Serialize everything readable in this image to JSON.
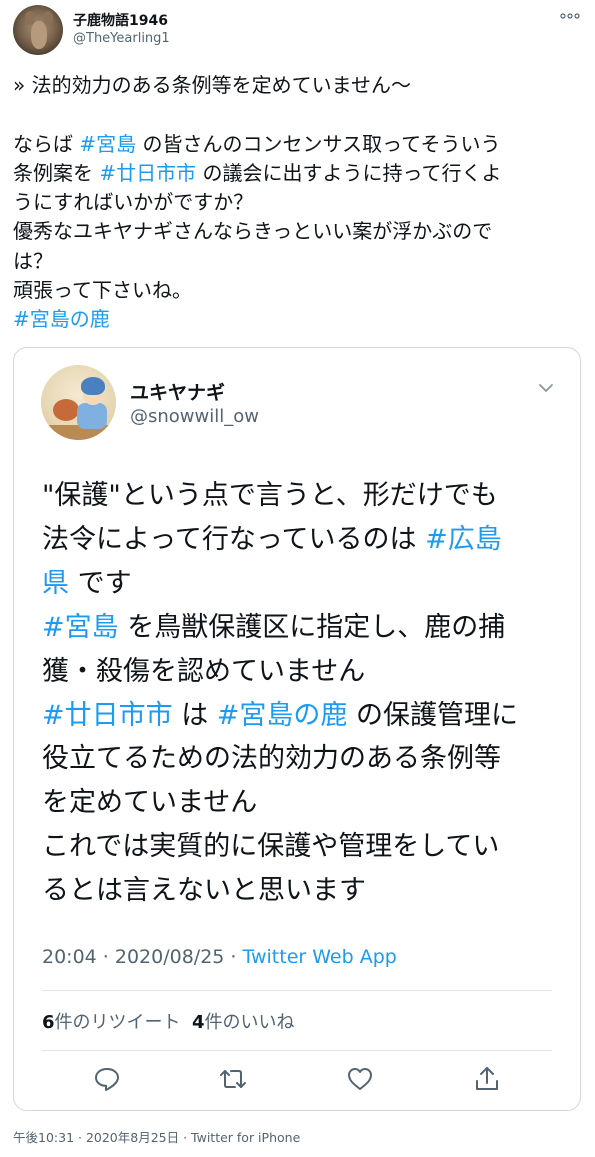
{
  "author": {
    "name": "子鹿物語1946",
    "handle": "@TheYearling1"
  },
  "more_menu": "◦◦◦",
  "tweet": {
    "lines": [
      "» 法的効力のある条例等を定めていません〜",
      "",
      "ならば ",
      "#宮島",
      " の皆さんのコンセンサス取ってそういう",
      "条例案を ",
      "#廿日市市",
      " の議会に出すように持って行くよ",
      "うにすればいかがですか？",
      "優秀なユキヤナギさんならきっといい案が浮かぶので",
      "は？",
      "頑張って下さいね。",
      "#宮島の鹿"
    ]
  },
  "quoted": {
    "name": "ユキヤナギ",
    "handle": "@snowwill_ow",
    "text": {
      "p1": "\"保護\"という点で言うと、形だけでも",
      "p2a": "法令によって行なっているのは ",
      "tag_hiroshima_a": "#広島",
      "tag_hiroshima_b": "県",
      "p2b": " です",
      "tag_miyajima": "#宮島",
      "p3a": " を鳥獣保護区に指定し、鹿の捕",
      "p3b": "獲・殺傷を認めていません",
      "tag_hatsukaichi": "#廿日市市",
      "p4a": " は ",
      "tag_miyajima_deer": "#宮島の鹿",
      "p4b": " の保護管理に",
      "p4c": "役立てるための法的効力のある条例等",
      "p4d": "を定めていません",
      "p5a": "これでは実質的に保護や管理をしてい",
      "p5b": "るとは言えないと思います"
    },
    "meta_time": "20:04 · 2020/08/25 · ",
    "meta_app": "Twitter Web App",
    "retweets_count": "6",
    "retweets_label": "件のリツイート",
    "likes_count": "4",
    "likes_label": "件のいいね"
  },
  "footer": "午後10:31 · 2020年8月25日 · Twitter for iPhone",
  "colors": {
    "link": "#1d9bf0",
    "text": "#0f1419",
    "muted": "#536471",
    "border": "#cfd9de"
  },
  "icons": [
    "more-icon",
    "chevron-down-icon",
    "reply-icon",
    "retweet-icon",
    "like-icon",
    "share-icon"
  ]
}
